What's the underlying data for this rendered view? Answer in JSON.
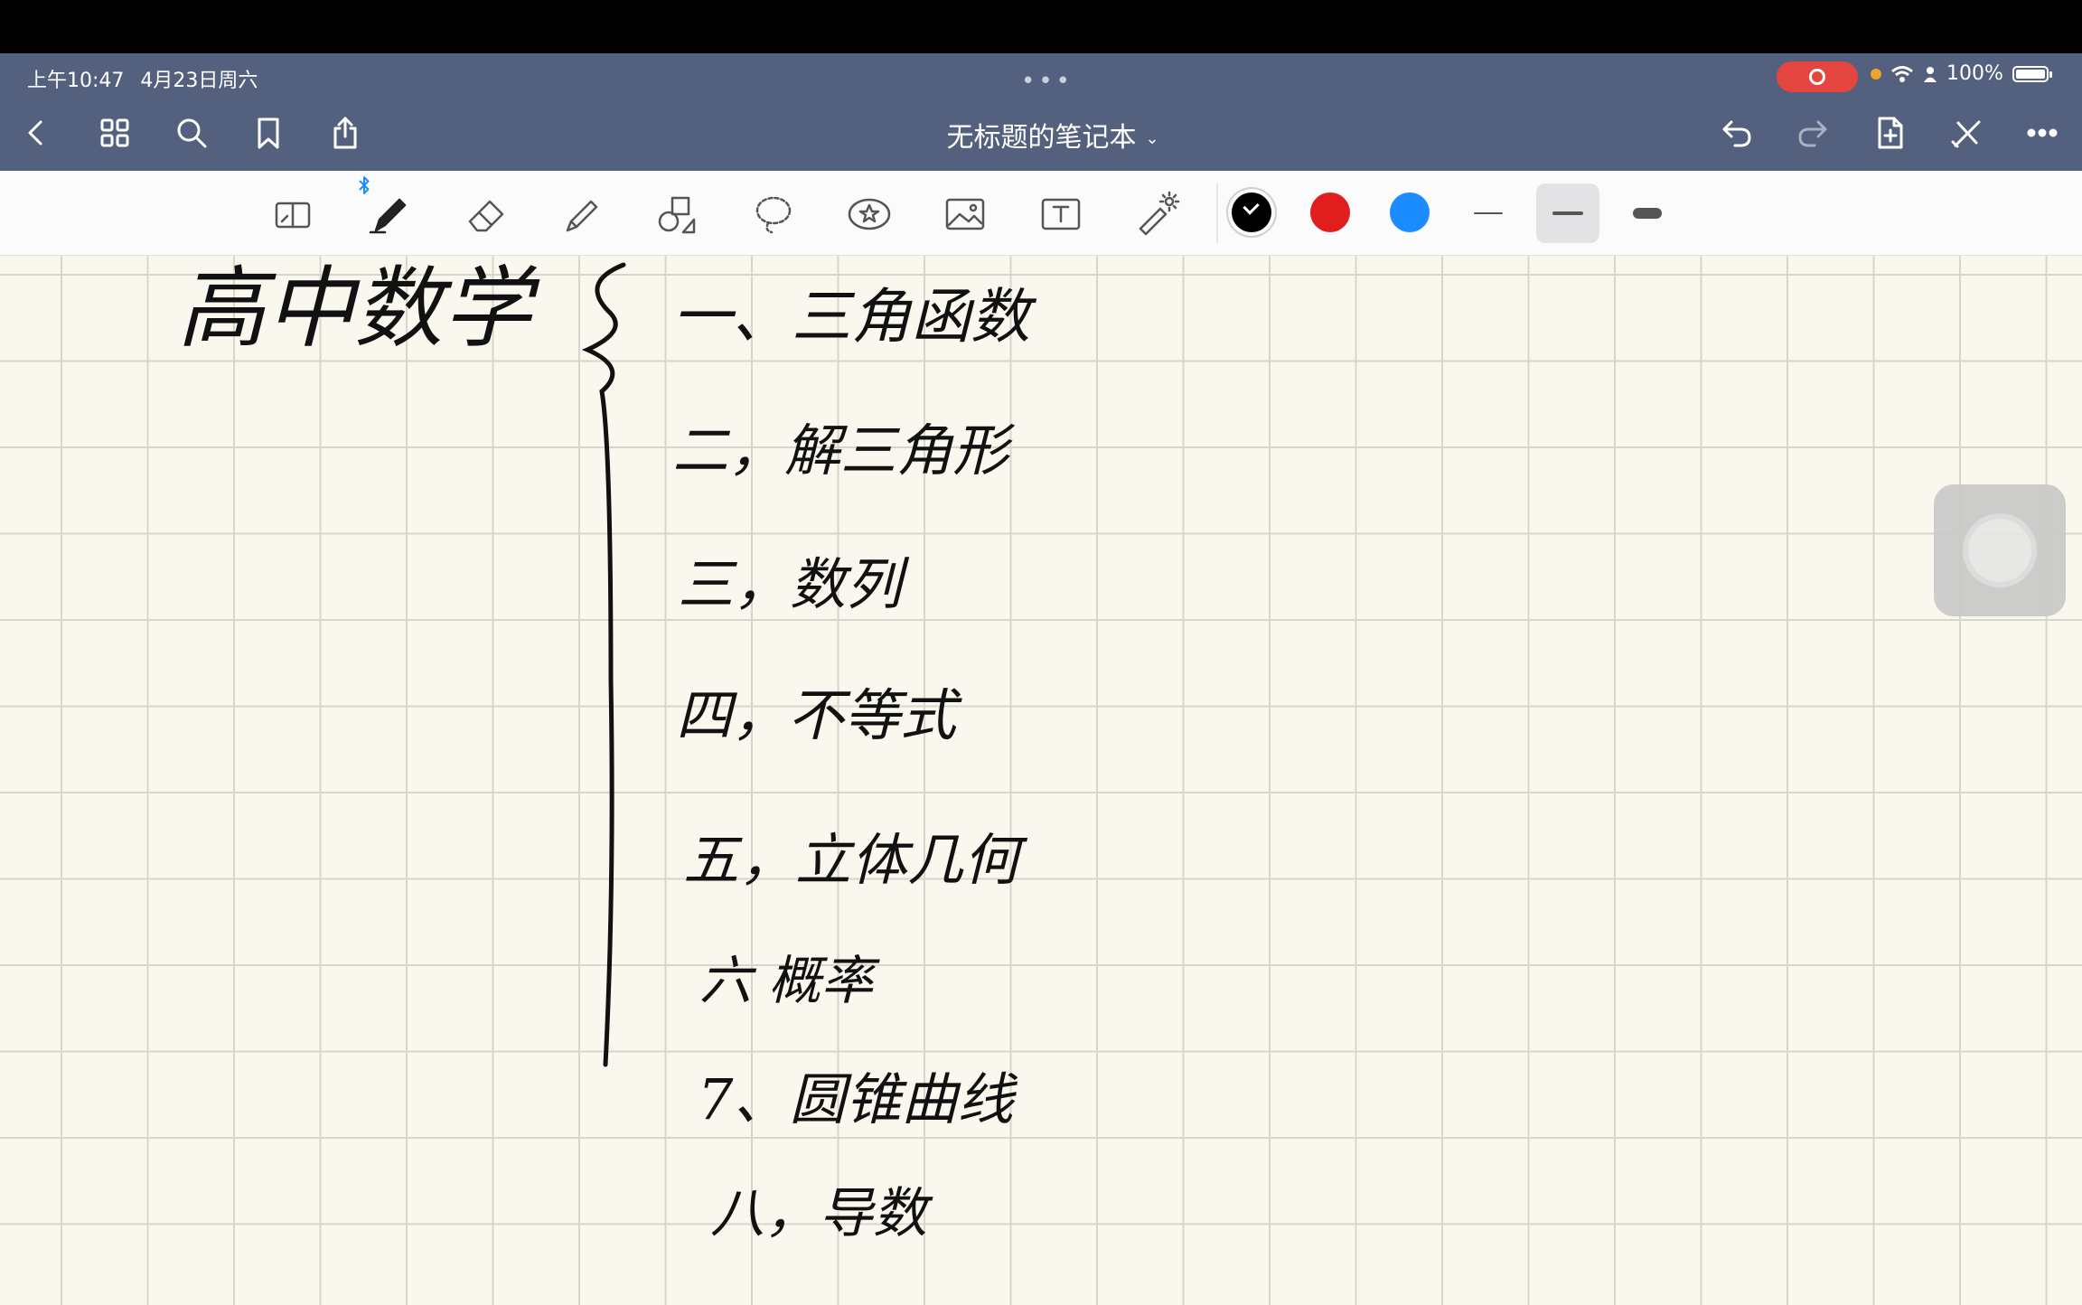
{
  "status": {
    "time": "上午10:47",
    "date": "4月23日周六",
    "handle": "•••",
    "battery_pct": "100%"
  },
  "nav": {
    "title": "无标题的笔记本",
    "title_chevron": "⌄",
    "left_icons": [
      "back-chevron-icon",
      "grid-icon",
      "search-icon",
      "bookmark-icon",
      "share-icon"
    ],
    "right_icons": [
      "undo-icon",
      "redo-icon",
      "add-page-icon",
      "close-icon",
      "more-icon"
    ]
  },
  "toolbar": {
    "tools": [
      "reading-mode-icon",
      "pen-icon",
      "eraser-icon",
      "highlighter-icon",
      "shapes-icon",
      "lasso-icon",
      "sticker-icon",
      "image-icon",
      "text-icon",
      "laser-pointer-icon"
    ],
    "colors": [
      "#000000",
      "#e01e1e",
      "#1a8cff"
    ],
    "selected_color_index": 0,
    "selected_width_index": 1
  },
  "note": {
    "title": "高中数学",
    "items": [
      "一、三角函数",
      "二，解三角形",
      "三，数列",
      "四，不等式",
      "五，立体几何",
      "六  概率",
      "7、圆锥曲线",
      "八，导数"
    ]
  }
}
